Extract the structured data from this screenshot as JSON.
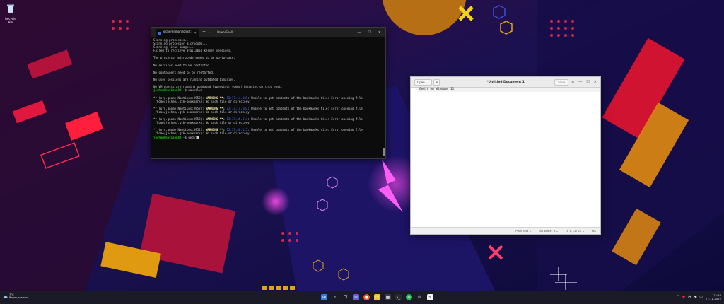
{
  "desktop": {
    "recycle_bin_label": "Recycle Bin"
  },
  "terminal": {
    "tab_label": "jochem@horizon8X: ~",
    "second_tab_label": "PowerShell",
    "lines": [
      "Scanning processes...",
      "Scanning processor microcode...",
      "Scanning linux images...",
      "",
      "Failed to retrieve available kernel versions.",
      "",
      "The processor microcode seems to be up-to-date.",
      "",
      "No services need to be restarted.",
      "",
      "No containers need to be restarted.",
      "",
      "No user sessions are running outdated binaries.",
      "",
      "No VM guests are running outdated hypervisor (qemu) binaries on this host."
    ],
    "prompt_user": "jochem@horizon8X",
    "prompt_path": "~",
    "cmd1": "nautilus",
    "warn_prefix": "** (org.gnome.Nautilus:3952):",
    "warn_word": "WARNING **:",
    "warnings": [
      {
        "ts": "12:37:14.581",
        "msg": "Unable to get contents of the bookmarks file: Error opening file",
        "path": " /home/jochem/.gtk-bookmarks: No such file or directory"
      },
      {
        "ts": "12:37:14.582",
        "msg": "Unable to get contents of the bookmarks file: Error opening file",
        "path": " /home/jochem/.gtk-bookmarks: No such file or directory"
      },
      {
        "ts": "12:37:46.114",
        "msg": "Unable to get contents of the bookmarks file: Error opening file",
        "path": " /home/jochem/.gtk-bookmarks: No such file or directory"
      },
      {
        "ts": "12:37:46.115",
        "msg": "Unable to get contents of the bookmarks file: Error opening file",
        "path": " /home/jochem/.gtk-bookmarks: No such file or directory"
      }
    ],
    "cmd2": "gedit"
  },
  "gedit": {
    "open_label": "Open",
    "title": "*Untitled Document 1",
    "save_label": "Save",
    "line_number": "1",
    "content": "Gedit op Windows 11!",
    "status": {
      "language": "Plain Text",
      "tab_width": "Tab Width: 8",
      "position": "Ln 1, Col 21",
      "mode": "INS"
    }
  },
  "taskbar": {
    "weather_temp": "7°C",
    "weather_desc": "Regen/sneeuw",
    "time": "12:38",
    "date": "27-11-2022"
  },
  "colors": {
    "terminal_bg": "#0c0c0c",
    "prompt_green": "#16c60c",
    "path_blue": "#3b78ff",
    "warning_yellow": "#f9f1a5"
  }
}
